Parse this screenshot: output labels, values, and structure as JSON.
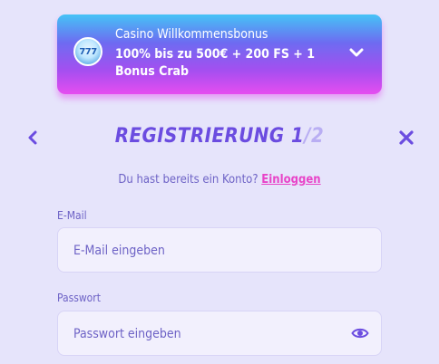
{
  "bonus": {
    "title": "Casino Willkommensbonus",
    "description": "100% bis zu 500€ + 200 FS + 1 Bonus Crab",
    "badge": "777"
  },
  "registration": {
    "title_main": "REGISTRIERUNG 1",
    "title_slash": "/2"
  },
  "account": {
    "question": "Du hast bereits ein Konto?",
    "login_link": "Einloggen"
  },
  "form": {
    "email_label": "E-Mail",
    "email_placeholder": "E-Mail eingeben",
    "password_label": "Passwort",
    "password_placeholder": "Passwort eingeben"
  },
  "colors": {
    "accent": "#6b4ce0",
    "link": "#e844c8",
    "background": "#e6e4fb"
  }
}
